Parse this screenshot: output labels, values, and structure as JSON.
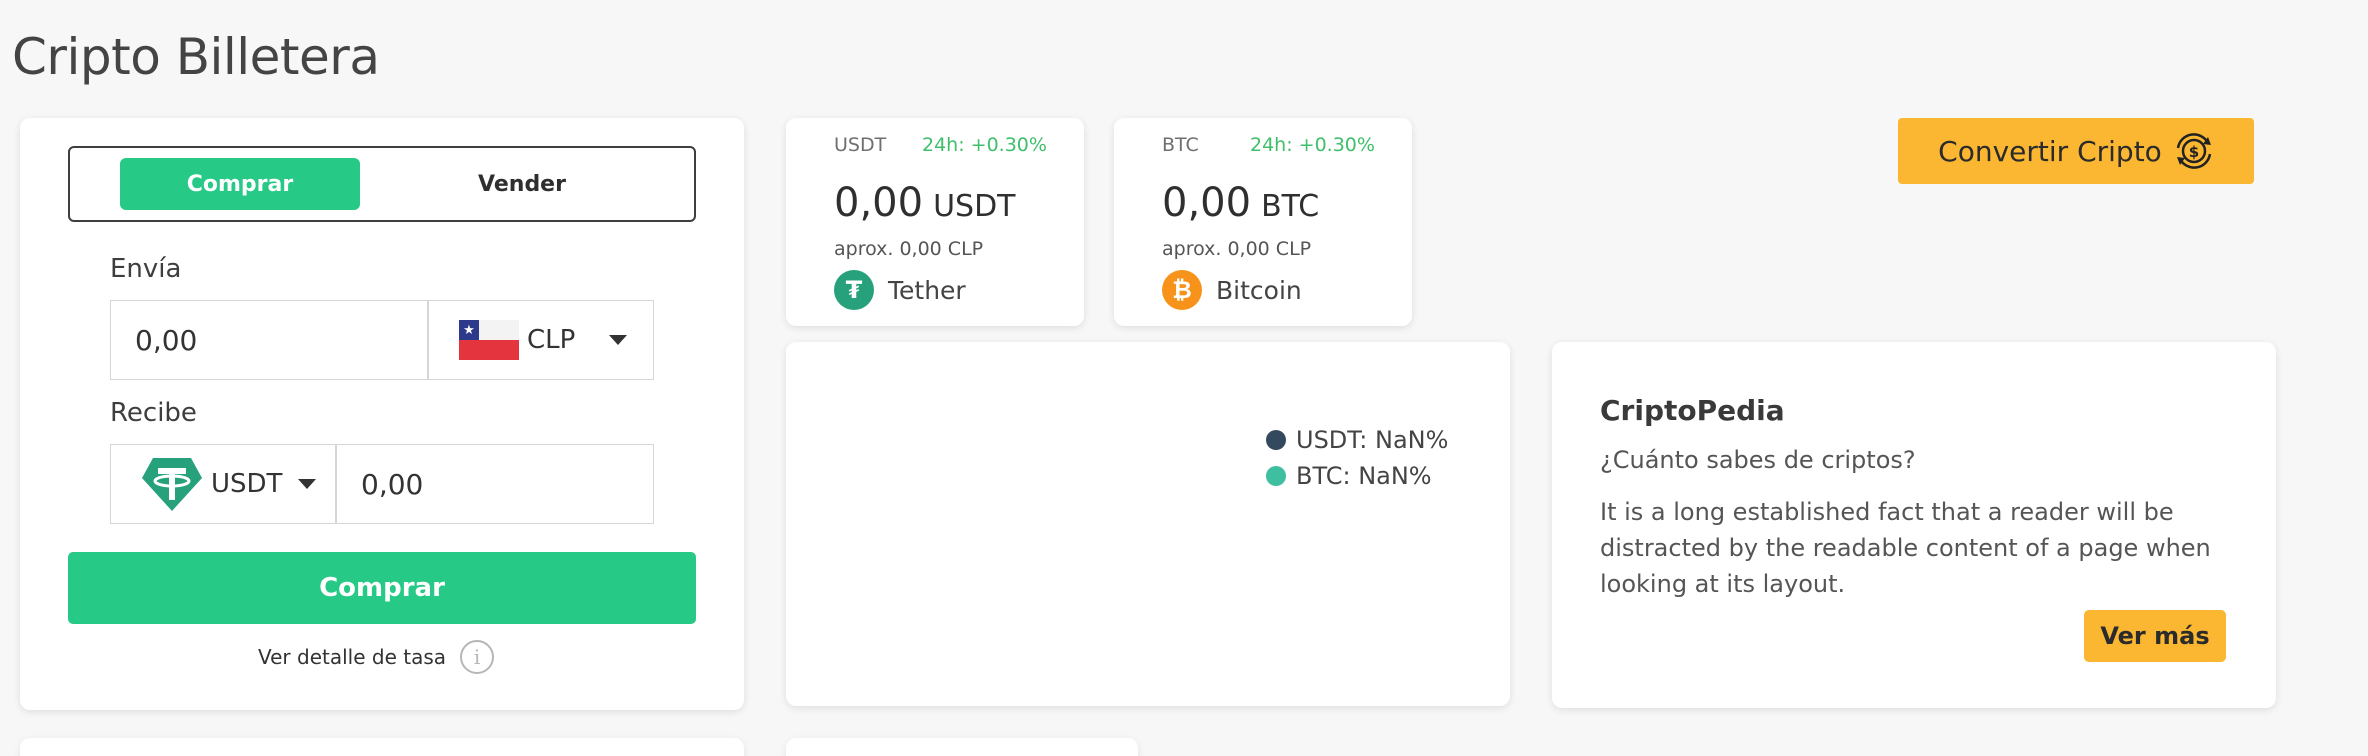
{
  "page": {
    "title": "Cripto Billetera"
  },
  "exchange": {
    "tabs": {
      "buy": "Comprar",
      "sell": "Vender"
    },
    "send": {
      "label": "Envía",
      "value": "0,00",
      "currency": "CLP"
    },
    "receive": {
      "label": "Recibe",
      "currency": "USDT",
      "value": "0,00"
    },
    "submit_label": "Comprar",
    "rate_link": "Ver detalle de tasa"
  },
  "balances": [
    {
      "symbol": "USDT",
      "change": "24h: +0.30%",
      "amount": "0,00",
      "unit": "USDT",
      "approx": "aprox. 0,00 CLP",
      "name": "Tether",
      "icon": "tether-icon",
      "color": "#26a17b"
    },
    {
      "symbol": "BTC",
      "change": "24h: +0.30%",
      "amount": "0,00",
      "unit": "BTC",
      "approx": "aprox. 0,00 CLP",
      "name": "Bitcoin",
      "icon": "bitcoin-icon",
      "color": "#f7931a"
    }
  ],
  "convert_button": {
    "label": "Convertir Cripto",
    "icon": "convert-crypto-icon"
  },
  "chart": {
    "legend": [
      {
        "label": "USDT: NaN%",
        "color": "#34495e"
      },
      {
        "label": "BTC: NaN%",
        "color": "#3dbfa0"
      }
    ]
  },
  "criptopedia": {
    "title": "CriptoPedia",
    "subtitle": "¿Cuánto sabes de criptos?",
    "body": "It is a long established fact that a reader will be distracted by the readable content of a page when looking at its layout.",
    "button": "Ver más"
  },
  "colors": {
    "accent_green": "#26c985",
    "accent_yellow": "#fbb731",
    "positive": "#3fbf6a"
  }
}
